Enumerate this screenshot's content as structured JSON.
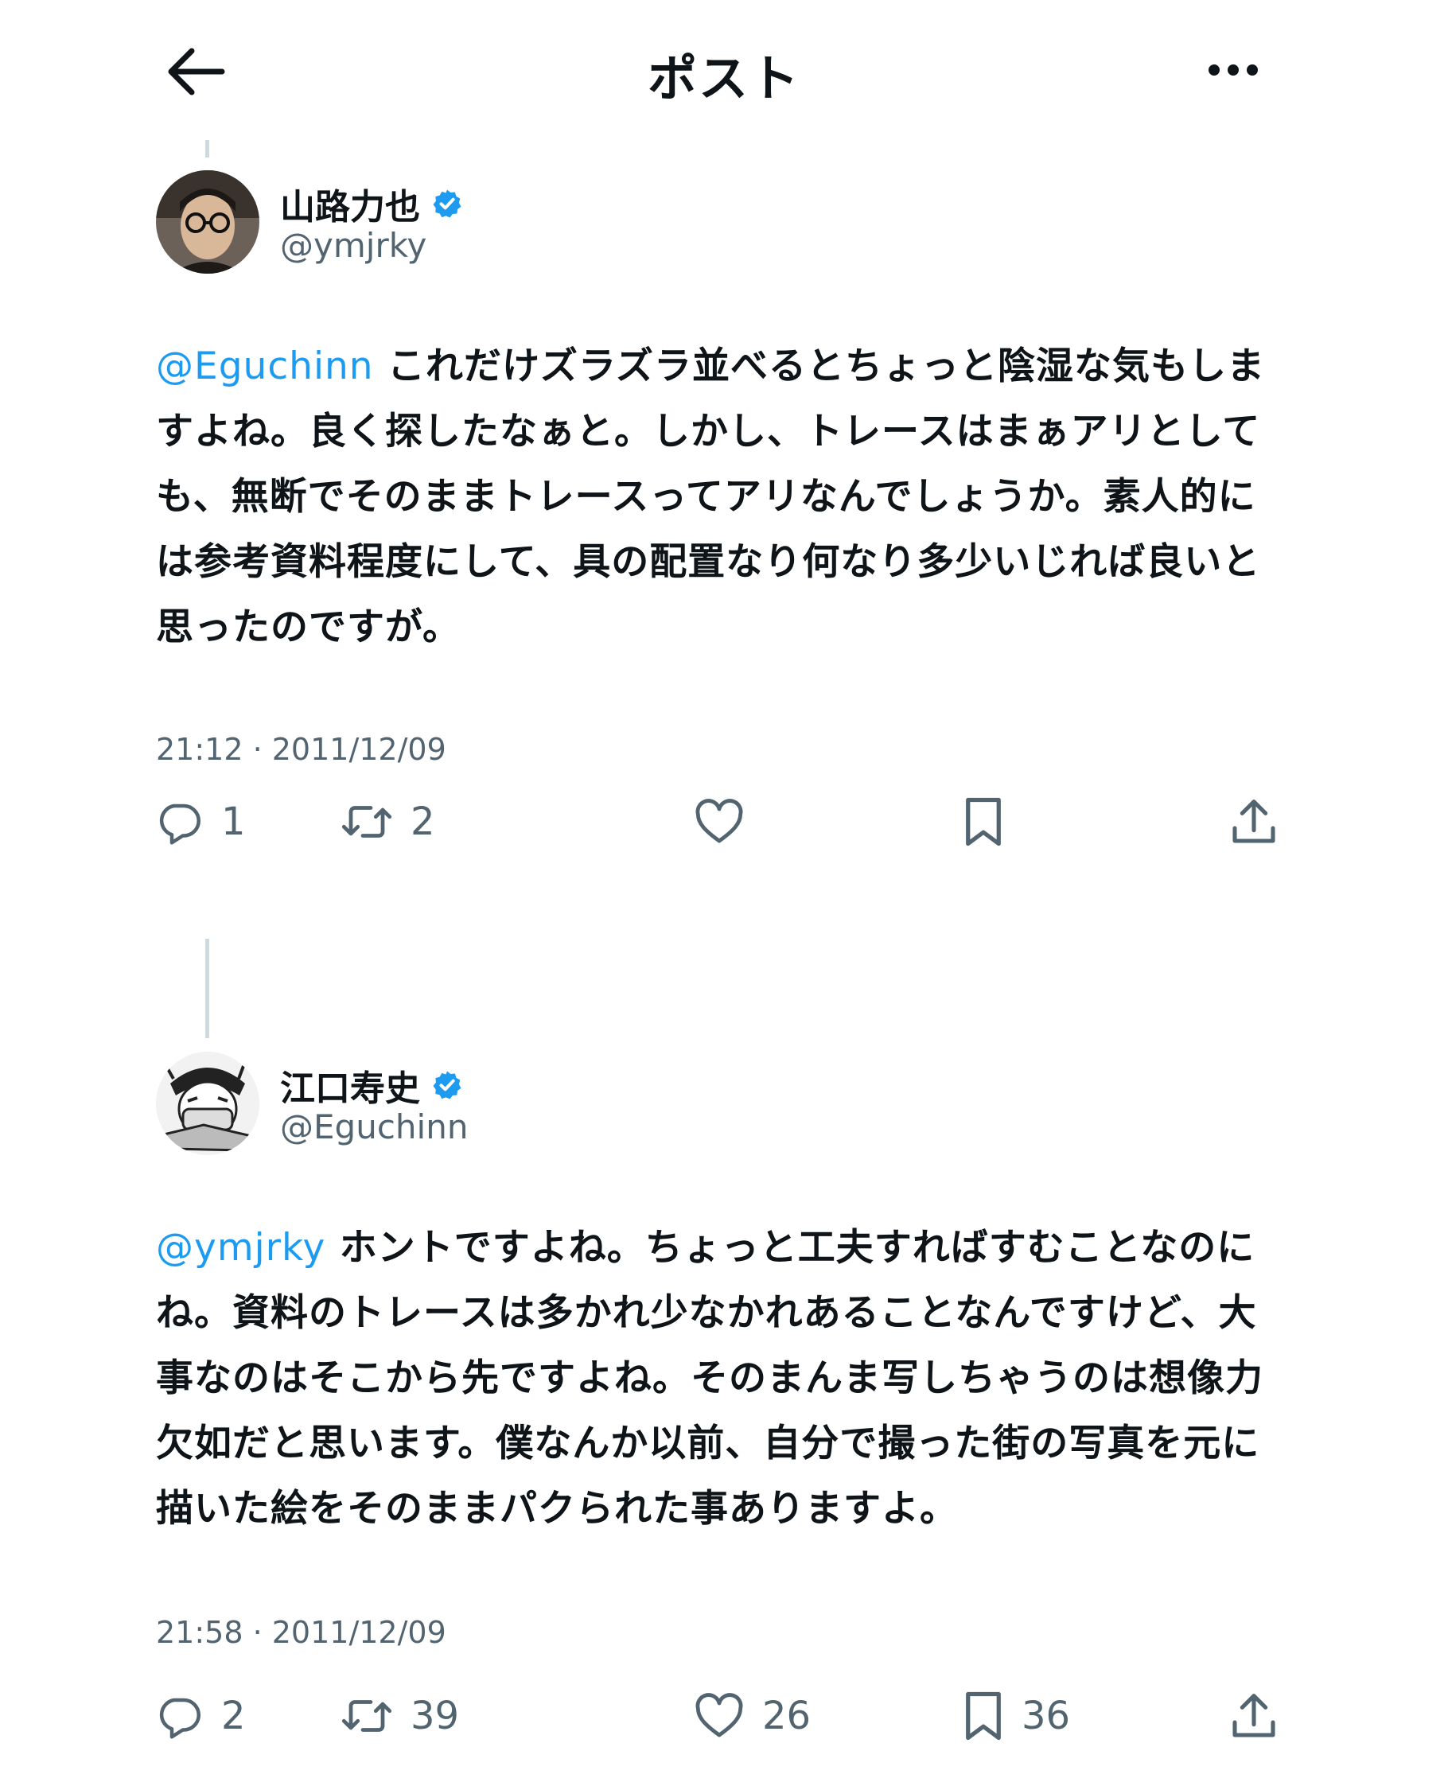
{
  "header": {
    "title": "ポスト"
  },
  "posts": [
    {
      "display_name": "山路力也",
      "handle": "@ymjrky",
      "mention": "@Eguchinn",
      "text": " これだけズラズラ並べるとちょっと陰湿な気もしますよね。良く探したなぁと。しかし、トレースはまぁアリとしても、無断でそのままトレースってアリなんでしょうか。素人的には参考資料程度にして、具の配置なり何なり多少いじれば良いと思ったのですが。",
      "timestamp": "21:12 · 2011/12/09",
      "replies": "1",
      "reposts": "2",
      "likes": "",
      "bookmarks": ""
    },
    {
      "display_name": "江口寿史",
      "handle": "@Eguchinn",
      "mention": "@ymjrky",
      "text": " ホントですよね。ちょっと工夫すればすむことなのにね。資料のトレースは多かれ少なかれあることなんですけど、大事なのはそこから先ですよね。そのまんま写しちゃうのは想像力欠如だと思います。僕なんか以前、自分で撮った街の写真を元に描いた絵をそのままパクられた事ありますよ。",
      "timestamp": "21:58 · 2011/12/09",
      "replies": "2",
      "reposts": "39",
      "likes": "26",
      "bookmarks": "36"
    }
  ],
  "colors": {
    "accent": "#1d9bf0",
    "text": "#0f1419",
    "secondary": "#536471",
    "thread_line": "#cfd9de"
  },
  "icons": [
    "back-arrow-icon",
    "more-icon",
    "verified-badge-icon",
    "reply-icon",
    "repost-icon",
    "like-icon",
    "bookmark-icon",
    "share-icon"
  ]
}
